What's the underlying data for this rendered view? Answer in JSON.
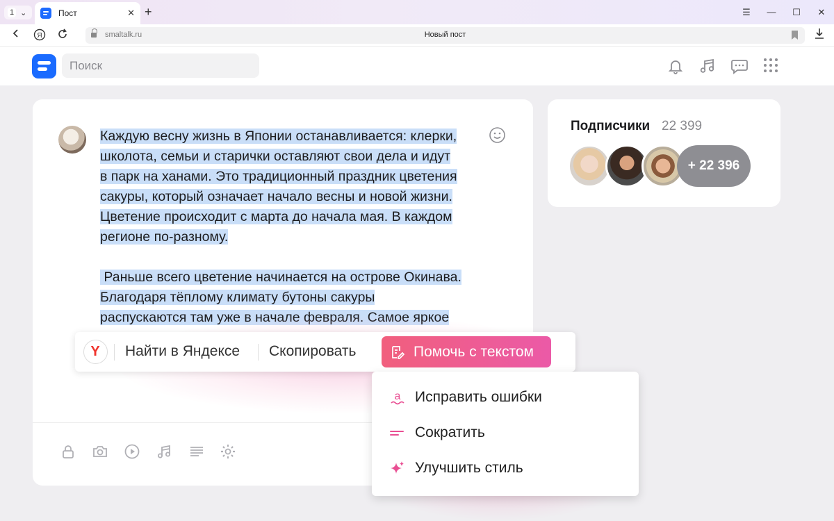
{
  "browser": {
    "tab_count": "1",
    "tab_title": "Пост",
    "url_host": "smaltalk.ru",
    "page_title": "Новый пост"
  },
  "header": {
    "search_placeholder": "Поиск",
    "icons": [
      "bell-icon",
      "music-icon",
      "messages-icon",
      "apps-grid-icon"
    ]
  },
  "post": {
    "lines": [
      "Каждую весну жизнь в Японии останавливается: клерки,",
      "школота, семьи и старички оставляют свои дела и идут",
      "в парк на ханами. Это традиционный праздник цветения",
      "сакуры, который означает начало весны и новой жизни.",
      "Цветение происходит с марта до начала мая. В каждом",
      "регионе по-разному.",
      "",
      " Раньше всего цветение начинается на острове Окинава.",
      "Благодаря тёплому климату бутоны сакуры",
      "распускаются там уже в начале февраля. Самое яркое"
    ],
    "tools": [
      "lock-icon",
      "camera-icon",
      "play-icon",
      "music-icon",
      "text-format-icon",
      "settings-icon"
    ]
  },
  "context_toolbar": {
    "search_label": "Найти в Яндексе",
    "copy_label": "Скопировать",
    "helper_label": "Помочь с текстом"
  },
  "helper_menu": {
    "items": [
      {
        "label": "Исправить ошибки",
        "icon": "fix-errors-icon"
      },
      {
        "label": "Сократить",
        "icon": "shorten-icon"
      },
      {
        "label": "Улучшить стиль",
        "icon": "sparkle-icon"
      }
    ]
  },
  "followers": {
    "title": "Подписчики",
    "count": "22 399",
    "more": "+ 22 396"
  },
  "colors": {
    "brand": "#1a6bff",
    "selection": "#c9def8",
    "helper_gradient_start": "#f15f7d",
    "helper_gradient_end": "#eb5aa7",
    "accent_pink": "#e94f93"
  }
}
